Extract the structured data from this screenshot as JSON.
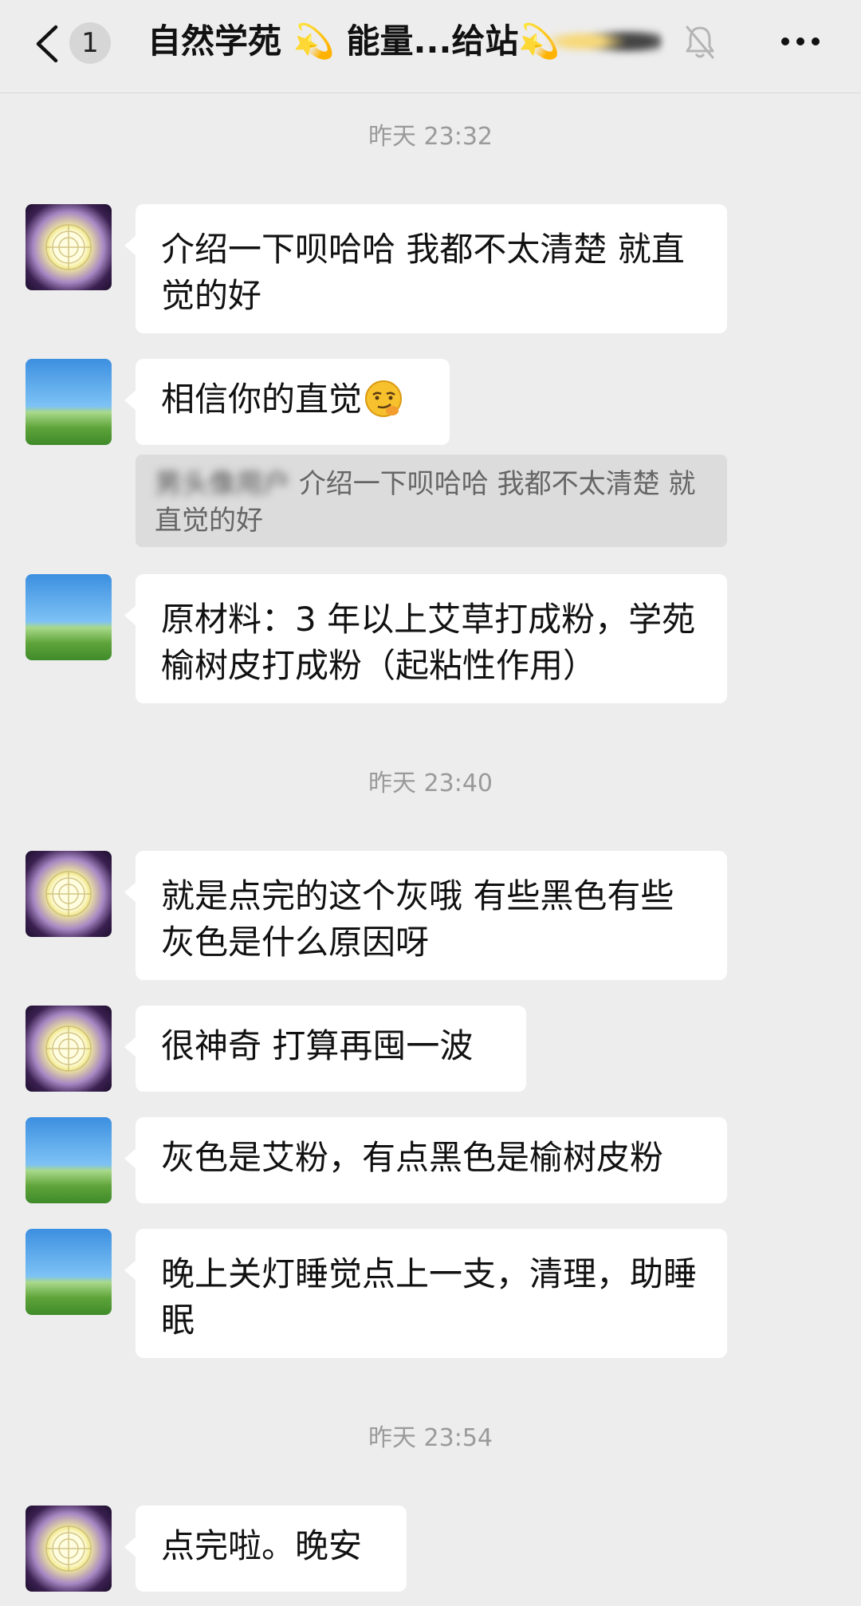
{
  "header": {
    "back_icon": "chevron-left-icon",
    "unread_count": "1",
    "title": "自然学苑 💫 能量...给站💫",
    "mute_icon": "bell-off-icon",
    "more_icon": "more-dots-icon"
  },
  "timestamps": [
    "昨天 23:32",
    "昨天 23:40",
    "昨天 23:54"
  ],
  "messages": [
    {
      "text": "介绍一下呗哈哈 我都不太清楚 就直觉的好"
    },
    {
      "text": "相信你的直觉"
    },
    {
      "text": "原材料：3 年以上艾草打成粉，学苑榆树皮打成粉（起粘性作用）"
    },
    {
      "text": "就是点完的这个灰哦 有些黑色有些灰色是什么原因呀"
    },
    {
      "text": "很神奇 打算再囤一波"
    },
    {
      "text": "灰色是艾粉，有点黑色是榆树皮粉"
    },
    {
      "text": "晚上关灯睡觉点上一支，清理，助睡眠"
    },
    {
      "text": "点完啦。晚安"
    }
  ],
  "quote": {
    "sender": "男头像用户",
    "text": "介绍一下呗哈哈 我都不太清楚 就直觉的好"
  },
  "emoji": "smirk-face-icon",
  "colors": {
    "background": "#ededed",
    "bubble": "#ffffff",
    "quote_bg": "#dcdcdc",
    "timestamp": "#9a9a9a"
  }
}
